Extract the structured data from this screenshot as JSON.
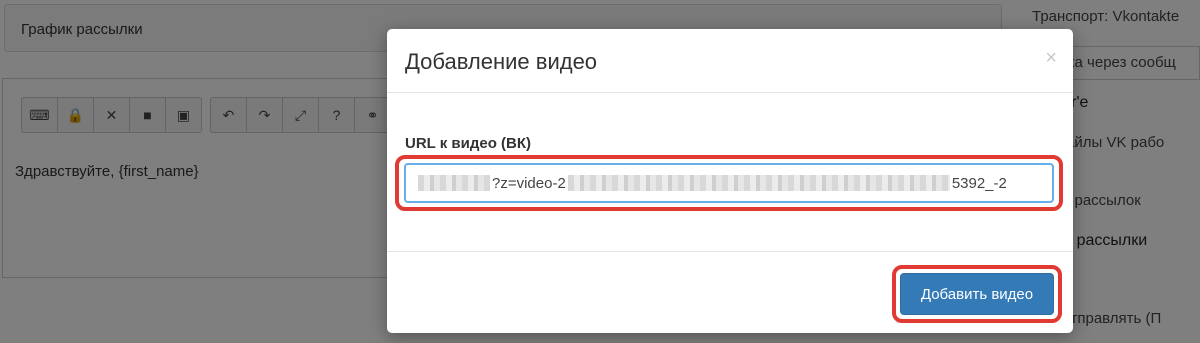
{
  "background": {
    "schedule_panel_title": "График рассылки",
    "toolbar_groups": [
      [
        "keyboard-icon",
        "lock-icon",
        "close-x-icon",
        "video-icon",
        "image-icon"
      ],
      [
        "undo-icon",
        "redo-icon",
        "fullscreen-icon",
        "help-icon",
        "link-icon"
      ]
    ],
    "toolbar_glyphs": {
      "keyboard-icon": "⌨",
      "lock-icon": "🔒",
      "close-x-icon": "✕",
      "video-icon": "■",
      "image-icon": "▣",
      "undo-icon": "↶",
      "redo-icon": "↷",
      "fullscreen-icon": "⤢",
      "help-icon": "?",
      "link-icon": "⚭"
    },
    "editor_text": "Здравствуйте, {first_name}",
    "right_column": {
      "transport": "Транспорт: Vkontakte",
      "send_via": "равка через сообщ",
      "group_value": "komor'e",
      "media_files": "иа-файлы VK рабо",
      "category_label": "гория рассылок",
      "category_value": "бщие рассылки",
      "send_to": "ому отправлять (П"
    }
  },
  "modal": {
    "title": "Добавление видео",
    "close_glyph": "×",
    "field_label": "URL к видео (ВК)",
    "url_visible_mid": "?z=video-2",
    "url_visible_end": "5392_-2",
    "submit_label": "Добавить видео"
  },
  "colors": {
    "primary_button": "#337ab7",
    "highlight": "#e03a33",
    "input_focus_border": "#66afe9",
    "backdrop": "rgba(0,0,0,0.5)"
  }
}
